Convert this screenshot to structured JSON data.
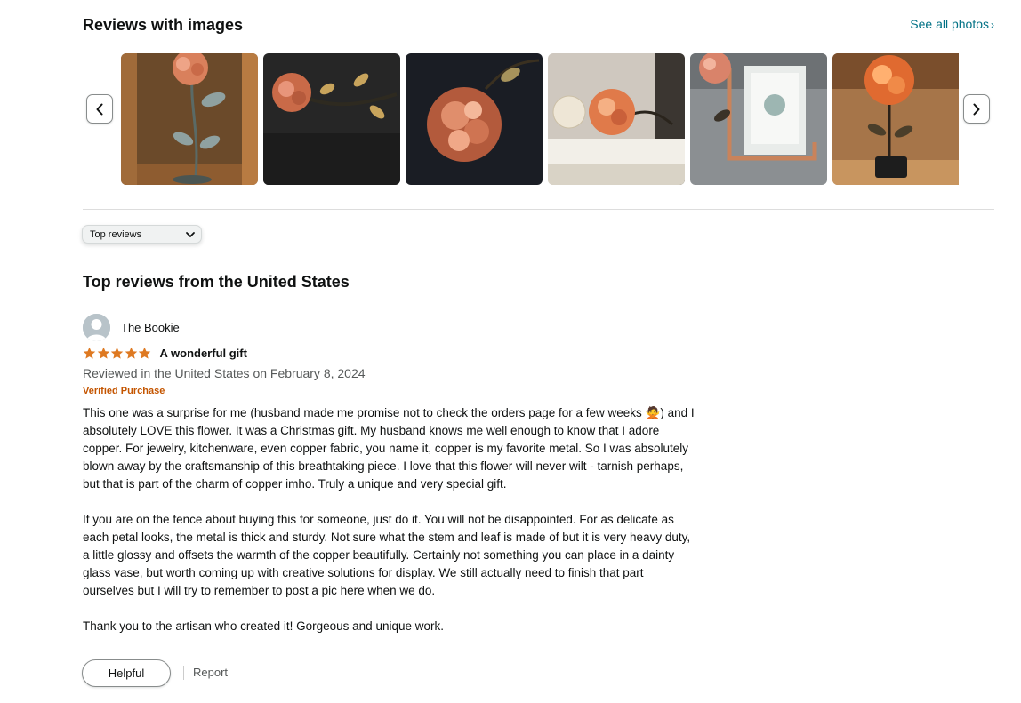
{
  "images_section": {
    "title": "Reviews with images",
    "see_all": "See all photos",
    "prev_icon": "chevron-left-icon",
    "next_icon": "chevron-right-icon",
    "image_count": 6
  },
  "sort": {
    "selected": "Top reviews"
  },
  "reviews_heading": "Top reviews from the United States",
  "review": {
    "reviewer": "The Bookie",
    "rating": 5,
    "rating_max": 5,
    "title": "A wonderful gift",
    "date": "Reviewed in the United States on February 8, 2024",
    "badge": "Verified Purchase",
    "paragraphs": [
      "This one was a surprise for me (husband made me promise not to check the orders page for a few weeks 🙅) and I absolutely LOVE this flower. It was a Christmas gift. My husband knows me well enough to know that I adore copper. For jewelry, kitchenware, even copper fabric, you name it, copper is my favorite metal. So I was absolutely blown away by the craftsmanship of this breathtaking piece. I love that this flower will never wilt - tarnish perhaps, but that is part of the charm of copper imho. Truly a unique and very special gift.",
      "If you are on the fence about buying this for someone, just do it. You will not be disappointed. For as delicate as each petal looks, the metal is thick and sturdy. Not sure what the stem and leaf is made of but it is very heavy duty, a little glossy and offsets the warmth of the copper beautifully. Certainly not something you can place in a dainty glass vase, but worth coming up with creative solutions for display. We still actually need to finish that part ourselves but I will try to remember to post a pic here when we do.",
      "Thank you to the artisan who created it! Gorgeous and unique work."
    ],
    "helpful_label": "Helpful",
    "report_label": "Report"
  },
  "colors": {
    "link": "#007185",
    "star": "#de7921",
    "verified": "#c45500",
    "muted": "#565959"
  }
}
